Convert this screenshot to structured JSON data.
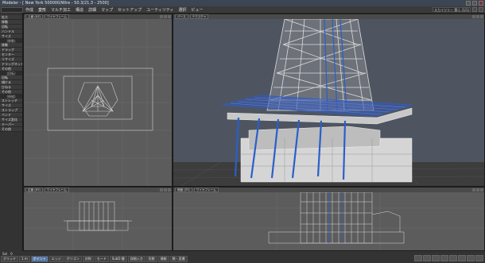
{
  "window": {
    "title": "Modeler  - [  New York 500000/Wire  -  50.3/21.3  -  2500]"
  },
  "menu": {
    "items": [
      "作成",
      "変形",
      "マルチ加工",
      "構造",
      "詳細",
      "マップ",
      "セットアップ",
      "ユーティリティ",
      "選択",
      "ビュー"
    ],
    "selected_index": 1,
    "right_combo": "スカイツリー 第二 (1/1)"
  },
  "sidebar": {
    "groups": [
      {
        "header": "",
        "items": [
          "拡大",
          "移動",
          "回転",
          "ハンドル",
          "サイズ"
        ]
      },
      {
        "header": "(移動)",
        "items": [
          "移動",
          "ドラッグ",
          "センター",
          "リサイズ",
          "ドラッグネット",
          "その他"
        ]
      },
      {
        "header": "(回転)",
        "items": [
          "回転",
          "傾ける",
          "ひねる",
          "その他"
        ]
      },
      {
        "header": "(伸縮)",
        "items": [
          "ストレッチ",
          "サイズ",
          "ストラップ",
          "ベンド",
          "サイズ変化",
          "テーパー",
          "その他"
        ]
      }
    ]
  },
  "viewports": {
    "top_left": {
      "view": "上面 (XZ)",
      "mode": "ワイヤフレーム"
    },
    "perspective": {
      "view": "パース",
      "mode": "テクスチャ"
    },
    "bottom_left": {
      "view": "正面 (XY)",
      "mode": "ワイヤフレーム"
    },
    "bottom_right": {
      "view": "側面 (ZY)",
      "mode": "ワイヤフレーム"
    }
  },
  "status": {
    "grid_label": "グリッド",
    "grid_value": "1 m",
    "sel_label": "Sel",
    "sel_value": "0",
    "buttons": [
      "ポイント",
      "エッジ",
      "ポリゴン",
      "対称",
      "モード",
      "SubD 種",
      "詳細入力",
      "形態",
      "情報",
      "数・変遷"
    ],
    "selected_index": 0
  },
  "colors": {
    "viewport_bg": "#5c5c5c",
    "wire": "#d8d8d8",
    "accent_blue": "#2a5fc9",
    "sky": "#4e5561"
  }
}
